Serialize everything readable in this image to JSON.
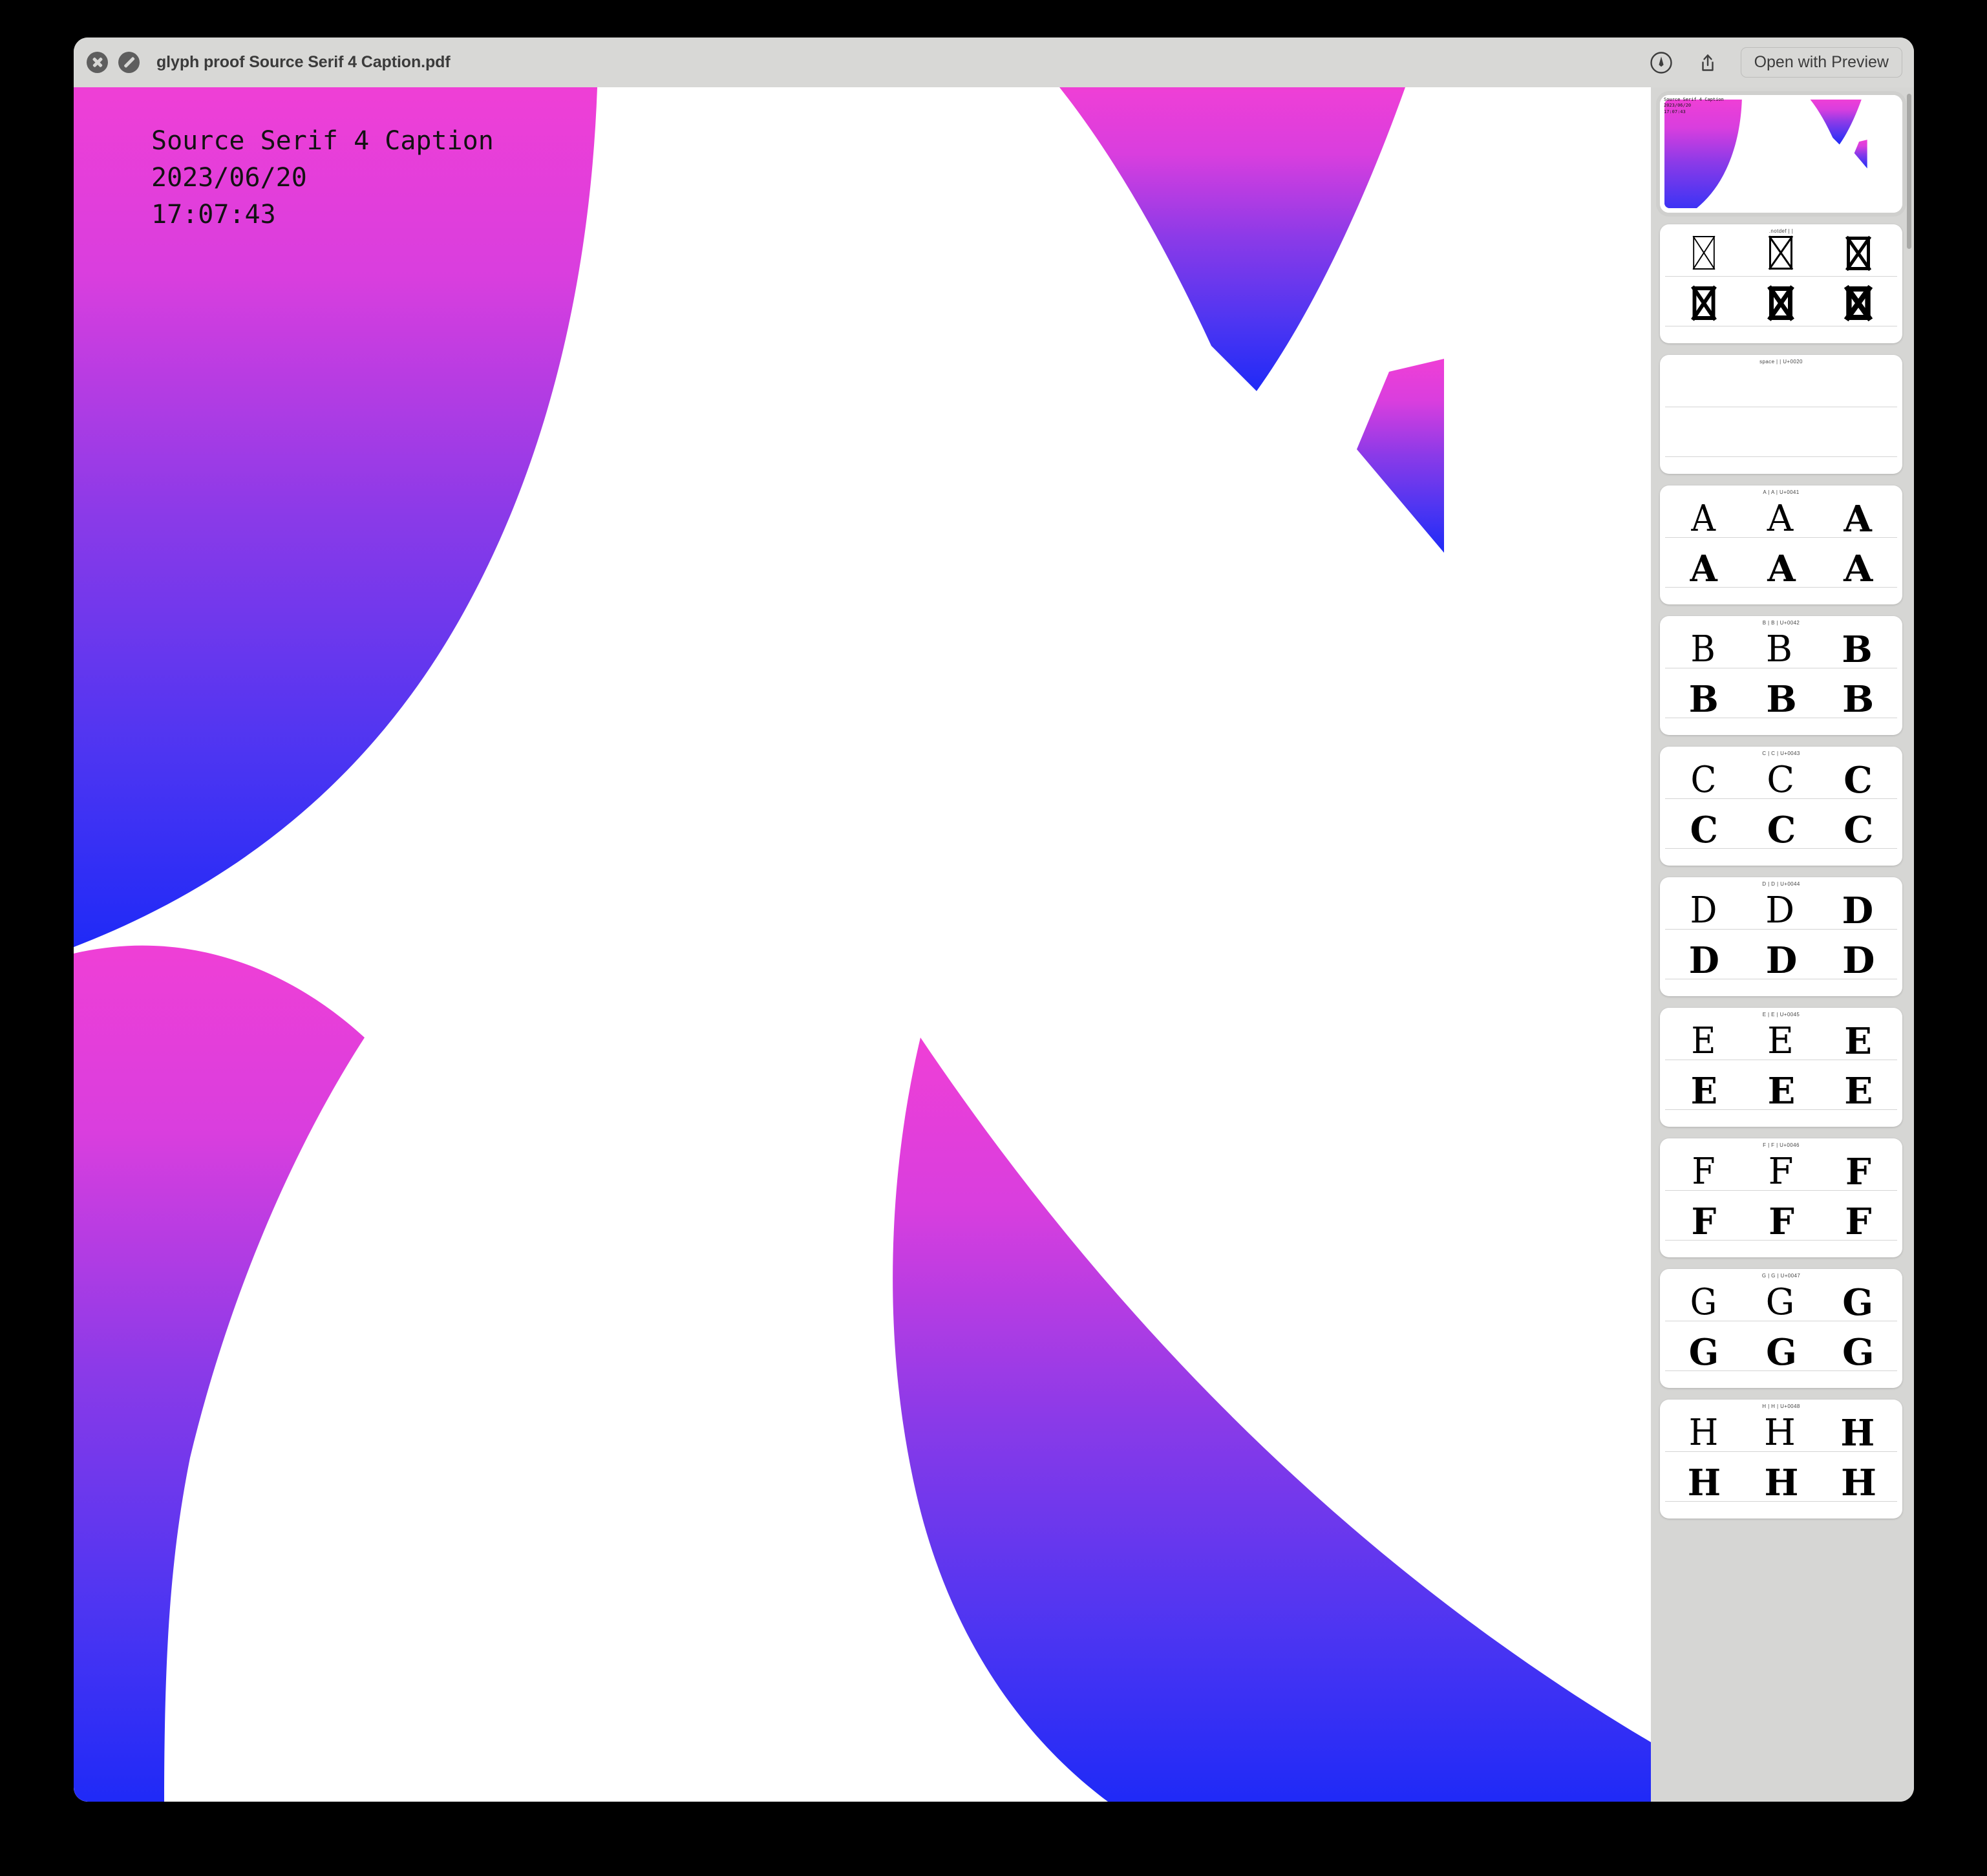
{
  "window": {
    "title": "glyph proof Source Serif 4 Caption.pdf",
    "close_label": "Close",
    "block_label": "Block",
    "markup_icon": "markup-pen-icon",
    "share_icon": "share-icon",
    "open_with_preview": "Open with Preview"
  },
  "cover": {
    "line1": "Source Serif 4 Caption",
    "line2": "2023/06/20",
    "line3": "17:07:43",
    "caption": "Source Serif 4 Caption\n2023/06/20\n17:07:43",
    "gradient_top": "#e844d8",
    "gradient_mid": "#8a3ae8",
    "gradient_bottom": "#2029f5",
    "background": "#ffffff"
  },
  "sidebar": {
    "background": "#d6d6d4",
    "card_background": "#ffffff",
    "thumbnails": [
      {
        "type": "cover",
        "name": "cover-page",
        "caption": "Source Serif 4 Caption\n2023/06/20\n17:07:43",
        "selected": true
      },
      {
        "type": "notdef",
        "name": "notdef-page",
        "header": ".notdef |  | ",
        "glyph": ".notdef"
      },
      {
        "type": "space",
        "name": "space-page",
        "header": "space |   | U+0020",
        "glyph": " "
      },
      {
        "type": "glyph",
        "name": "glyph-page-A",
        "header": "A | A | U+0041",
        "glyph": "A"
      },
      {
        "type": "glyph",
        "name": "glyph-page-B",
        "header": "B | B | U+0042",
        "glyph": "B"
      },
      {
        "type": "glyph",
        "name": "glyph-page-C",
        "header": "C | C | U+0043",
        "glyph": "C"
      },
      {
        "type": "glyph",
        "name": "glyph-page-D",
        "header": "D | D | U+0044",
        "glyph": "D"
      },
      {
        "type": "glyph",
        "name": "glyph-page-E",
        "header": "E | E | U+0045",
        "glyph": "E"
      },
      {
        "type": "glyph",
        "name": "glyph-page-F",
        "header": "F | F | U+0046",
        "glyph": "F"
      },
      {
        "type": "glyph",
        "name": "glyph-page-G",
        "header": "G | G | U+0047",
        "glyph": "G"
      },
      {
        "type": "glyph",
        "name": "glyph-page-H",
        "header": "H | H | U+0048",
        "glyph": "H"
      }
    ]
  }
}
